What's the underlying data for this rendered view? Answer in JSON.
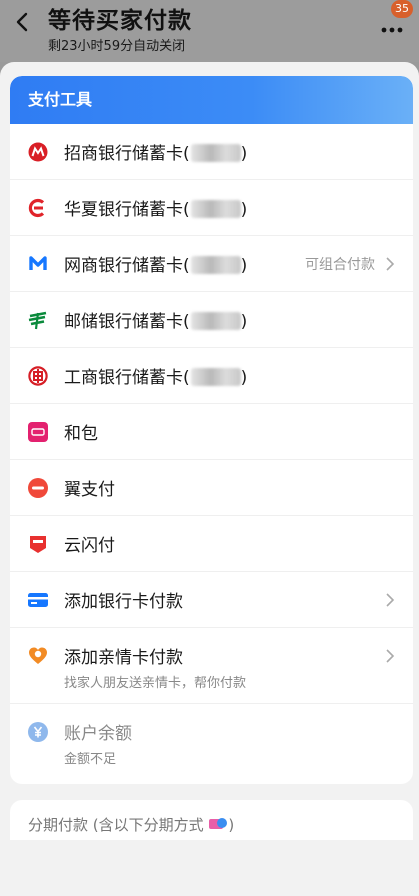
{
  "header": {
    "title": "等待买家付款",
    "subtitle": "剩23小时59分自动关闭",
    "badge": "35"
  },
  "panel": {
    "title": "支付工具"
  },
  "methods": [
    {
      "label": "招商银行储蓄卡(",
      "icon": "cmb-bank-icon",
      "masked": true,
      "close": ")"
    },
    {
      "label": "华夏银行储蓄卡(",
      "icon": "hxb-bank-icon",
      "masked": true,
      "close": ")"
    },
    {
      "label": "网商银行储蓄卡(",
      "icon": "mybank-icon",
      "masked": true,
      "close": ")",
      "right": "可组合付款"
    },
    {
      "label": "邮储银行储蓄卡(",
      "icon": "psbc-bank-icon",
      "masked": true,
      "close": ")"
    },
    {
      "label": "工商银行储蓄卡(",
      "icon": "icbc-bank-icon",
      "masked": true,
      "close": ")"
    },
    {
      "label": "和包",
      "icon": "hebao-icon"
    },
    {
      "label": "翼支付",
      "icon": "bestpay-icon"
    },
    {
      "label": "云闪付",
      "icon": "unionpay-quickpass-icon"
    },
    {
      "label": "添加银行卡付款",
      "icon": "bank-card-icon"
    },
    {
      "label": "添加亲情卡付款",
      "icon": "family-card-icon",
      "desc": "找家人朋友送亲情卡，帮你付款"
    },
    {
      "label": "账户余额",
      "icon": "balance-icon",
      "desc": "金额不足"
    }
  ],
  "installment": {
    "label": "分期付款 (含以下分期方式"
  },
  "colors": {
    "accent": "#2f7cf3",
    "brand_red": "#e0242a"
  }
}
